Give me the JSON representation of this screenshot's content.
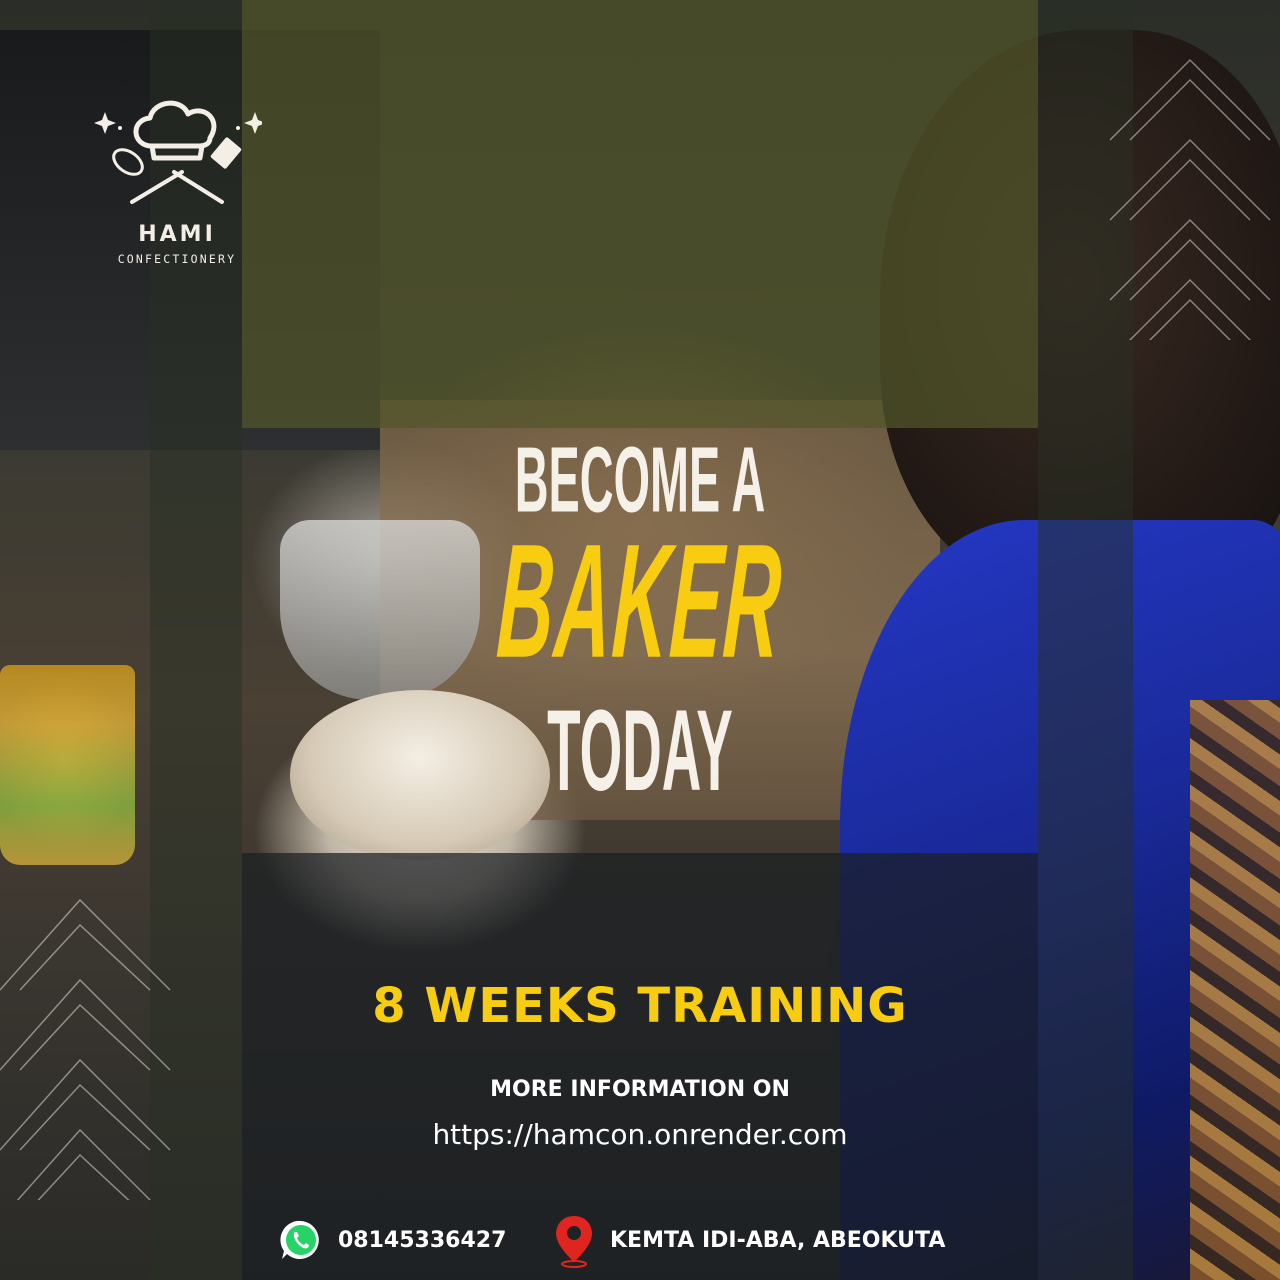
{
  "brand": {
    "name": "HAMI",
    "tagline": "CONFECTIONERY"
  },
  "headline": {
    "line1": "BECOME A",
    "line2": "BAKER",
    "line3": "TODAY"
  },
  "training": "8 WEEKS TRAINING",
  "info": {
    "label": "MORE INFORMATION ON",
    "url": "https://hamcon.onrender.com"
  },
  "contact": {
    "phone": "08145336427",
    "phone_icon": "whatsapp-icon",
    "location": "KEMTA IDI-ABA, ABEOKUTA",
    "location_icon": "map-pin-icon"
  },
  "colors": {
    "accent_yellow": "#f7cc11",
    "text_light": "#f5f1e8",
    "pin_red": "#e0241f",
    "whatsapp_green": "#25d366"
  }
}
